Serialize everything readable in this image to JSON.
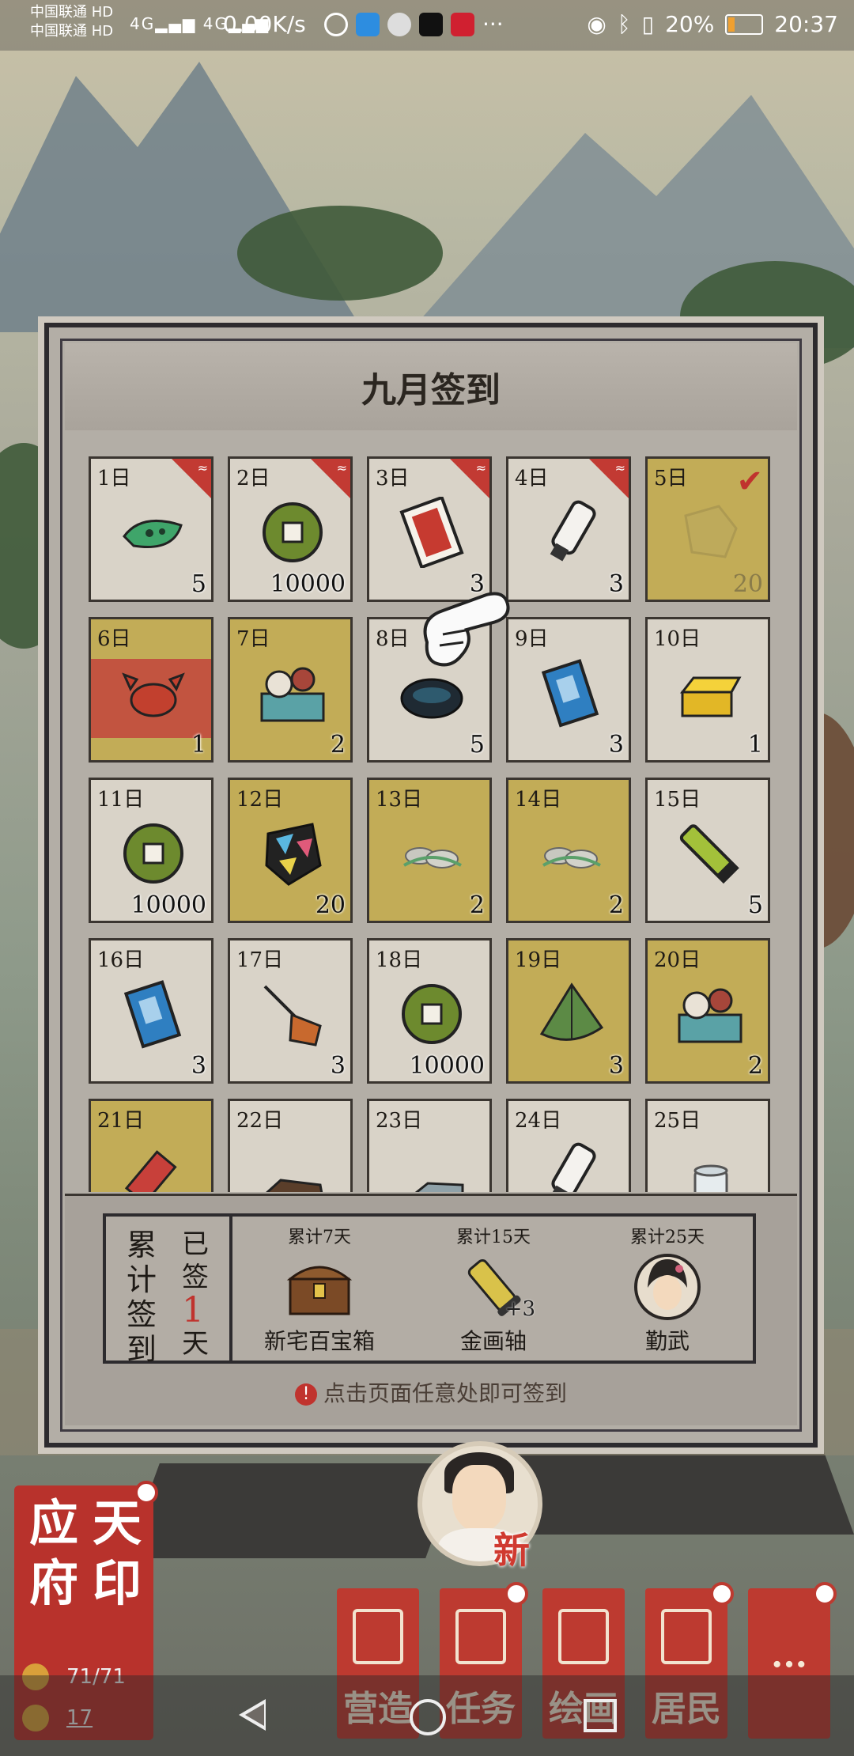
{
  "status_bar": {
    "carrier_1": "中国联通",
    "carrier_2": "中国联通",
    "hd": "HD",
    "signal": "4G",
    "speed": "0.00K/s",
    "more": "···",
    "battery": "20%",
    "battery_level": 0.2,
    "time": "20:37"
  },
  "signin": {
    "title": "九月签到",
    "days": [
      {
        "day": "1日",
        "qty": "5",
        "icon": "tea-leaf-icon",
        "state": "new"
      },
      {
        "day": "2日",
        "qty": "10000",
        "icon": "copper-coin-icon",
        "state": "new"
      },
      {
        "day": "3日",
        "qty": "3",
        "icon": "red-ticket-icon",
        "state": "new"
      },
      {
        "day": "4日",
        "qty": "3",
        "icon": "scroll-icon",
        "state": "new"
      },
      {
        "day": "5日",
        "qty": "20",
        "icon": "jade-stone-icon",
        "state": "claimed"
      },
      {
        "day": "6日",
        "qty": "1",
        "icon": "crab-icon",
        "state": "today"
      },
      {
        "day": "7日",
        "qty": "2",
        "icon": "gift-box-icon",
        "state": "gold"
      },
      {
        "day": "8日",
        "qty": "5",
        "icon": "ink-stone-icon",
        "state": "plain"
      },
      {
        "day": "9日",
        "qty": "3",
        "icon": "blue-book-icon",
        "state": "plain"
      },
      {
        "day": "10日",
        "qty": "1",
        "icon": "gold-bar-icon",
        "state": "plain"
      },
      {
        "day": "11日",
        "qty": "10000",
        "icon": "copper-coin-icon",
        "state": "plain"
      },
      {
        "day": "12日",
        "qty": "20",
        "icon": "color-gem-icon",
        "state": "gold"
      },
      {
        "day": "13日",
        "qty": "2",
        "icon": "stone-pile-icon",
        "state": "gold"
      },
      {
        "day": "14日",
        "qty": "2",
        "icon": "stone-pile-icon",
        "state": "gold"
      },
      {
        "day": "15日",
        "qty": "5",
        "icon": "bamboo-tube-icon",
        "state": "plain"
      },
      {
        "day": "16日",
        "qty": "3",
        "icon": "blue-book-icon",
        "state": "plain"
      },
      {
        "day": "17日",
        "qty": "3",
        "icon": "broom-icon",
        "state": "plain"
      },
      {
        "day": "18日",
        "qty": "10000",
        "icon": "copper-coin-icon",
        "state": "plain"
      },
      {
        "day": "19日",
        "qty": "3",
        "icon": "leaf-fan-icon",
        "state": "gold"
      },
      {
        "day": "20日",
        "qty": "2",
        "icon": "gift-box-icon",
        "state": "gold"
      },
      {
        "day": "21日",
        "qty": "",
        "icon": "firecracker-icon",
        "state": "gold"
      },
      {
        "day": "22日",
        "qty": "",
        "icon": "wood-icon",
        "state": "plain"
      },
      {
        "day": "23日",
        "qty": "",
        "icon": "stone-slab-icon",
        "state": "plain"
      },
      {
        "day": "24日",
        "qty": "",
        "icon": "scroll-icon",
        "state": "plain"
      },
      {
        "day": "25日",
        "qty": "",
        "icon": "porcelain-jar-icon",
        "state": "plain"
      }
    ],
    "cumulative": {
      "label": [
        "累",
        "计",
        "签",
        "到"
      ],
      "signed_prefix": [
        "已",
        "签"
      ],
      "signed_count": "1",
      "signed_suffix": "天",
      "rewards": [
        {
          "caption": "累计7天",
          "name": "新宅百宝箱",
          "icon": "treasure-chest-icon",
          "extra": ""
        },
        {
          "caption": "累计15天",
          "name": "金画轴",
          "icon": "gold-scroll-icon",
          "extra": "+3"
        },
        {
          "caption": "累计25天",
          "name": "勤武",
          "icon": "character-portrait-icon",
          "extra": ""
        }
      ]
    },
    "hint": "点击页面任意处即可签到",
    "hint_icon": "!"
  },
  "hud": {
    "seal": {
      "chars": [
        "应",
        "天",
        "府",
        "印"
      ],
      "stat_1": "71/71",
      "stat_2": "17"
    },
    "new_label": "新",
    "menu": [
      {
        "label": "营造",
        "icon": "building-icon",
        "dot": false
      },
      {
        "label": "任务",
        "icon": "task-icon",
        "dot": true
      },
      {
        "label": "绘画",
        "icon": "painting-icon",
        "dot": false
      },
      {
        "label": "居民",
        "icon": "resident-icon",
        "dot": true
      },
      {
        "label": "···",
        "icon": "more-icon",
        "dot": true
      }
    ]
  },
  "colors": {
    "accent_red": "#c0332e",
    "gold_cell": "#c2ac57",
    "paper": "#d9d3c8"
  }
}
